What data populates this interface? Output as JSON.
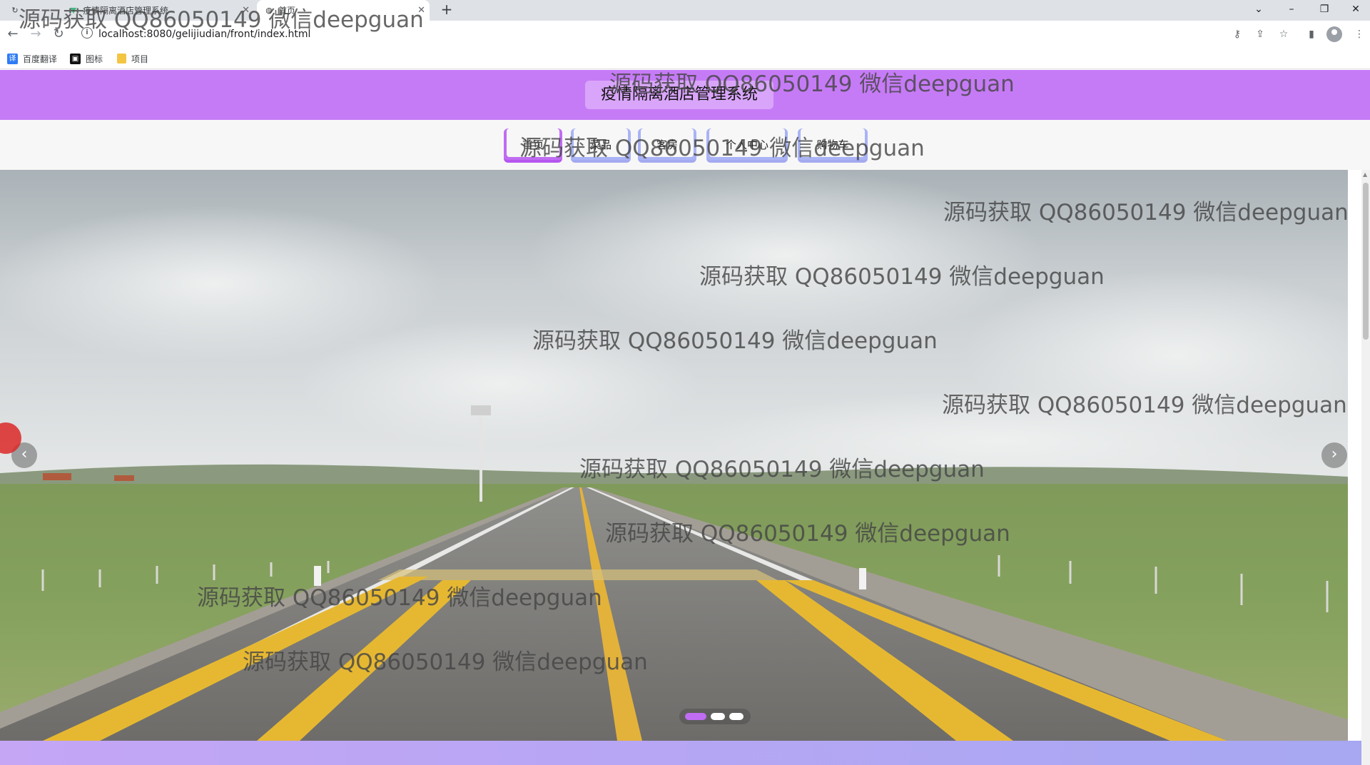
{
  "browser": {
    "tabs": [
      {
        "title": "",
        "icon": "spinner-icon"
      },
      {
        "title": "疫情隔离酒店管理系统",
        "icon": "vue-icon"
      },
      {
        "title": "首页",
        "icon": "globe-icon"
      }
    ],
    "new_tab": "+",
    "url": "localhost:8080/gelijiudian/front/index.html",
    "bookmarks": [
      {
        "label": "百度翻译",
        "icon": "translate-icon",
        "color": "#2f7bf5"
      },
      {
        "label": "图标",
        "icon": "image-icon",
        "color": "#111111"
      },
      {
        "label": "项目",
        "icon": "folder-icon",
        "color": "#f4c542"
      }
    ]
  },
  "site": {
    "title": "疫情隔离酒店管理系统",
    "nav": [
      {
        "label": "首页",
        "active": true
      },
      {
        "label": "菜品",
        "active": false
      },
      {
        "label": "客房",
        "active": false
      },
      {
        "label": "个人中心",
        "active": false
      },
      {
        "label": "购物车",
        "active": false
      }
    ]
  },
  "carousel": {
    "slide_count": 3,
    "active_slide": 1,
    "prev": "‹",
    "next": "›"
  },
  "watermark": "源码获取 QQ86050149 微信deepguan",
  "colors": {
    "header": "#c67bf6",
    "nav_active": "#c06cf3",
    "nav_item": "#a9b3f5"
  }
}
